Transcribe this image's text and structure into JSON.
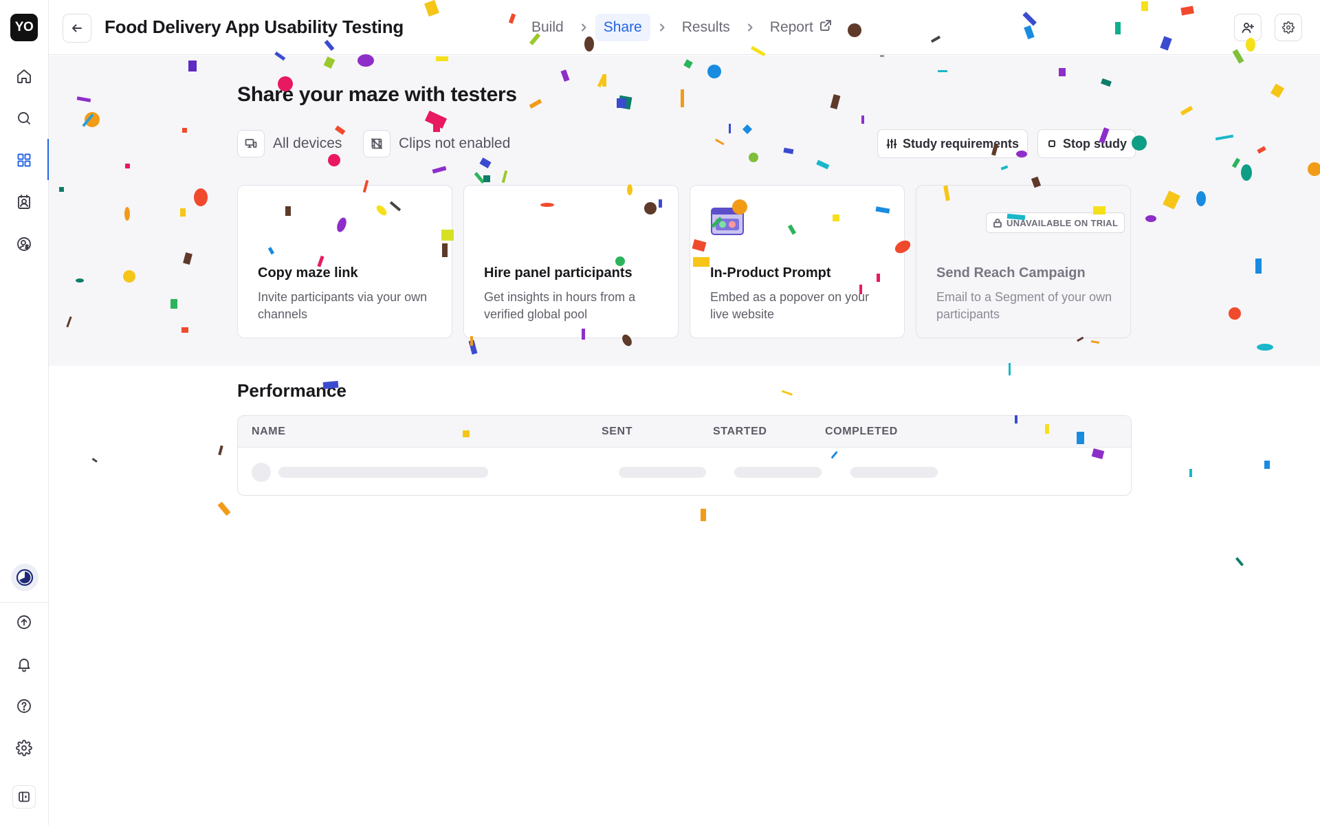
{
  "user": {
    "avatar_initials": "YO"
  },
  "sidebar": {
    "items": [
      {
        "name": "home",
        "icon": "home-icon"
      },
      {
        "name": "search",
        "icon": "search-icon"
      },
      {
        "name": "projects",
        "icon": "grid-icon"
      },
      {
        "name": "participants",
        "icon": "contacts-icon"
      },
      {
        "name": "billing",
        "icon": "user-dollar-icon"
      }
    ],
    "bottom_items": [
      {
        "name": "timer",
        "icon": "clock-icon"
      },
      {
        "name": "upload",
        "icon": "upload-icon"
      },
      {
        "name": "notifications",
        "icon": "bell-icon"
      },
      {
        "name": "help",
        "icon": "help-icon"
      },
      {
        "name": "settings",
        "icon": "gear-icon"
      },
      {
        "name": "collapse",
        "icon": "sidebar-collapse-icon"
      }
    ]
  },
  "header": {
    "title": "Food Delivery App Usability Testing",
    "steps": [
      "Build",
      "Share",
      "Results",
      "Report"
    ],
    "active_step": "Share"
  },
  "share": {
    "heading": "Share your maze with testers",
    "devices_label": "All devices",
    "clips_label": "Clips not enabled",
    "requirements_label": "Study requirements",
    "stop_label": "Stop study",
    "cards": [
      {
        "title": "Copy maze link",
        "desc": "Invite participants via your own channels"
      },
      {
        "title": "Hire panel participants",
        "desc": "Get insights in hours from a verified global pool"
      },
      {
        "title": "In-Product Prompt",
        "desc": "Embed as a popover on your live website"
      },
      {
        "title": "Send Reach Campaign",
        "desc": "Email to a Segment of your own participants",
        "badge": "UNAVAILABLE ON TRIAL"
      }
    ]
  },
  "performance": {
    "heading": "Performance",
    "columns": [
      "NAME",
      "SENT",
      "STARTED",
      "COMPLETED"
    ]
  },
  "colors": {
    "accent": "#2363e4",
    "band": "#f6f6f9"
  }
}
